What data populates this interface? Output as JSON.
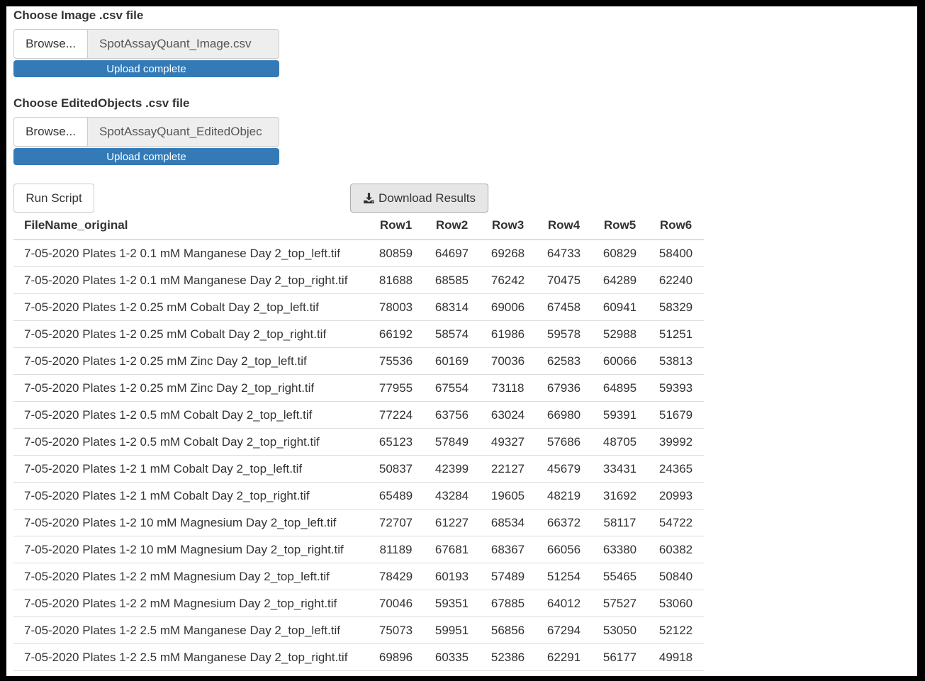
{
  "upload_image": {
    "label": "Choose Image .csv file",
    "browse_label": "Browse...",
    "file_name": "SpotAssayQuant_Image.csv",
    "progress_text": "Upload complete"
  },
  "upload_objects": {
    "label": "Choose EditedObjects .csv file",
    "browse_label": "Browse...",
    "file_name": "SpotAssayQuant_EditedObjec",
    "progress_text": "Upload complete"
  },
  "actions": {
    "run_label": "Run Script",
    "download_label": "Download Results",
    "download_icon": "download-icon"
  },
  "table": {
    "headers": [
      "FileName_original",
      "Row1",
      "Row2",
      "Row3",
      "Row4",
      "Row5",
      "Row6"
    ],
    "rows": [
      [
        "7-05-2020 Plates 1-2 0.1 mM Manganese Day 2_top_left.tif",
        "80859",
        "64697",
        "69268",
        "64733",
        "60829",
        "58400"
      ],
      [
        "7-05-2020 Plates 1-2 0.1 mM Manganese Day 2_top_right.tif",
        "81688",
        "68585",
        "76242",
        "70475",
        "64289",
        "62240"
      ],
      [
        "7-05-2020 Plates 1-2 0.25 mM Cobalt Day 2_top_left.tif",
        "78003",
        "68314",
        "69006",
        "67458",
        "60941",
        "58329"
      ],
      [
        "7-05-2020 Plates 1-2 0.25 mM Cobalt Day 2_top_right.tif",
        "66192",
        "58574",
        "61986",
        "59578",
        "52988",
        "51251"
      ],
      [
        "7-05-2020 Plates 1-2 0.25 mM Zinc Day 2_top_left.tif",
        "75536",
        "60169",
        "70036",
        "62583",
        "60066",
        "53813"
      ],
      [
        "7-05-2020 Plates 1-2 0.25 mM Zinc Day 2_top_right.tif",
        "77955",
        "67554",
        "73118",
        "67936",
        "64895",
        "59393"
      ],
      [
        "7-05-2020 Plates 1-2 0.5 mM Cobalt Day 2_top_left.tif",
        "77224",
        "63756",
        "63024",
        "66980",
        "59391",
        "51679"
      ],
      [
        "7-05-2020 Plates 1-2 0.5 mM Cobalt Day 2_top_right.tif",
        "65123",
        "57849",
        "49327",
        "57686",
        "48705",
        "39992"
      ],
      [
        "7-05-2020 Plates 1-2 1 mM Cobalt Day 2_top_left.tif",
        "50837",
        "42399",
        "22127",
        "45679",
        "33431",
        "24365"
      ],
      [
        "7-05-2020 Plates 1-2 1 mM Cobalt Day 2_top_right.tif",
        "65489",
        "43284",
        "19605",
        "48219",
        "31692",
        "20993"
      ],
      [
        "7-05-2020 Plates 1-2 10 mM Magnesium Day 2_top_left.tif",
        "72707",
        "61227",
        "68534",
        "66372",
        "58117",
        "54722"
      ],
      [
        "7-05-2020 Plates 1-2 10 mM Magnesium Day 2_top_right.tif",
        "81189",
        "67681",
        "68367",
        "66056",
        "63380",
        "60382"
      ],
      [
        "7-05-2020 Plates 1-2 2 mM Magnesium Day 2_top_left.tif",
        "78429",
        "60193",
        "57489",
        "51254",
        "55465",
        "50840"
      ],
      [
        "7-05-2020 Plates 1-2 2 mM Magnesium Day 2_top_right.tif",
        "70046",
        "59351",
        "67885",
        "64012",
        "57527",
        "53060"
      ],
      [
        "7-05-2020 Plates 1-2 2.5 mM Manganese Day 2_top_left.tif",
        "75073",
        "59951",
        "56856",
        "67294",
        "53050",
        "52122"
      ],
      [
        "7-05-2020 Plates 1-2 2.5 mM Manganese Day 2_top_right.tif",
        "69896",
        "60335",
        "52386",
        "62291",
        "56177",
        "49918"
      ]
    ]
  },
  "colors": {
    "progress": "#337ab7",
    "file_name_bg": "#eeeeee",
    "download_bg": "#e6e6e6"
  }
}
